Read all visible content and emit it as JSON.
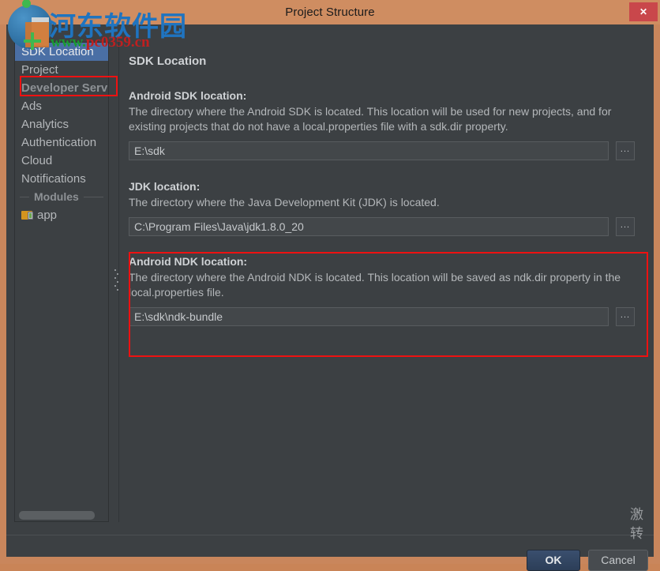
{
  "window": {
    "title": "Project Structure",
    "close_label": "✕"
  },
  "sidebar": {
    "items": [
      {
        "label": "SDK Location",
        "type": "item",
        "selected": true
      },
      {
        "label": "Project",
        "type": "item",
        "selected": false
      },
      {
        "label": "Developer Services",
        "type": "group",
        "selected": false
      },
      {
        "label": "Ads",
        "type": "item",
        "selected": false
      },
      {
        "label": "Analytics",
        "type": "item",
        "selected": false
      },
      {
        "label": "Authentication",
        "type": "item",
        "selected": false
      },
      {
        "label": "Cloud",
        "type": "item",
        "selected": false
      },
      {
        "label": "Notifications",
        "type": "item",
        "selected": false
      }
    ],
    "modules_separator": "Modules",
    "modules": [
      {
        "label": "app",
        "icon": "android-module-icon"
      }
    ]
  },
  "content": {
    "page_title": "SDK Location",
    "sections": [
      {
        "id": "sdk",
        "label": "Android SDK location:",
        "description": "The directory where the Android SDK is located. This location will be used for new projects, and for existing projects that do not have a local.properties file with a sdk.dir property.",
        "value": "E:\\sdk",
        "browse_label": "...",
        "highlighted": false
      },
      {
        "id": "jdk",
        "label": "JDK location:",
        "description": "The directory where the Java Development Kit (JDK) is located.",
        "value": "C:\\Program Files\\Java\\jdk1.8.0_20",
        "browse_label": "...",
        "highlighted": false
      },
      {
        "id": "ndk",
        "label": "Android NDK location:",
        "description": "The directory where the Android NDK is located. This location will be saved as ndk.dir property in the local.properties file.",
        "value": "E:\\sdk\\ndk-bundle",
        "browse_label": "...",
        "highlighted": true
      }
    ]
  },
  "footer": {
    "ok_label": "OK",
    "cancel_label": "Cancel"
  },
  "watermarks": {
    "site_name": "河东软件园",
    "url_prefix": "www.",
    "url_domain": "pc0359.cn",
    "activation_line1": "激",
    "activation_line2": "转"
  },
  "colors": {
    "titlebar": "#cf8d61",
    "close_button": "#c9474b",
    "dialog_background": "#3c4043",
    "selection": "#4a6fa5",
    "annotation": "#ee1111",
    "ok_button": "#2c3e58"
  }
}
